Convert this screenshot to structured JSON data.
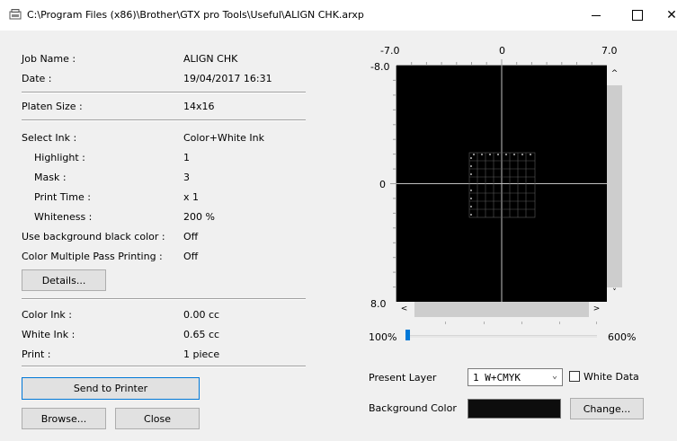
{
  "window": {
    "title": "C:\\Program Files (x86)\\Brother\\GTX pro Tools\\Useful\\ALIGN CHK.arxp",
    "minimize_glyph": "–",
    "close_glyph": "✕"
  },
  "info": {
    "job_name_label": "Job Name :",
    "job_name_value": "ALIGN CHK",
    "date_label": "Date :",
    "date_value": "19/04/2017 16:31",
    "platen_label": "Platen Size :",
    "platen_value": "14x16",
    "select_ink_label": "Select Ink :",
    "select_ink_value": "Color+White Ink",
    "highlight_label": "Highlight :",
    "highlight_value": "1",
    "mask_label": "Mask :",
    "mask_value": "3",
    "print_time_label": "Print Time :",
    "print_time_value": "x 1",
    "whiteness_label": "Whiteness :",
    "whiteness_value": "200 %",
    "bg_black_label": "Use background black color :",
    "bg_black_value": "Off",
    "multipass_label": "Color Multiple Pass Printing :",
    "multipass_value": "Off",
    "details_button": "Details...",
    "color_ink_label": "Color Ink :",
    "color_ink_value": "0.00 cc",
    "white_ink_label": "White Ink :",
    "white_ink_value": "0.65 cc",
    "print_label": "Print :",
    "print_value": "1 piece"
  },
  "actions": {
    "send_to_printer": "Send to Printer",
    "browse": "Browse...",
    "close": "Close"
  },
  "preview": {
    "x_min_label": "-7.0",
    "x_mid_label": "0",
    "x_max_label": "7.0",
    "y_min_label": "-8.0",
    "y_mid_label": "0",
    "y_max_label": "8.0",
    "scroll_up": "^",
    "scroll_down": "˅",
    "scroll_left": "<",
    "scroll_right": ">"
  },
  "zoom": {
    "min_label": "100%",
    "max_label": "600%",
    "value_percent": 100
  },
  "layer": {
    "present_layer_label": "Present Layer",
    "present_layer_value": "1  W+CMYK",
    "white_data_label": "White Data",
    "white_data_checked": false,
    "background_color_label": "Background Color",
    "background_color": "#0d0d0d",
    "change_button": "Change..."
  },
  "colors": {
    "accent": "#0078d7",
    "preview_bg": "#000000",
    "crosshair": "#bfbfbf"
  }
}
